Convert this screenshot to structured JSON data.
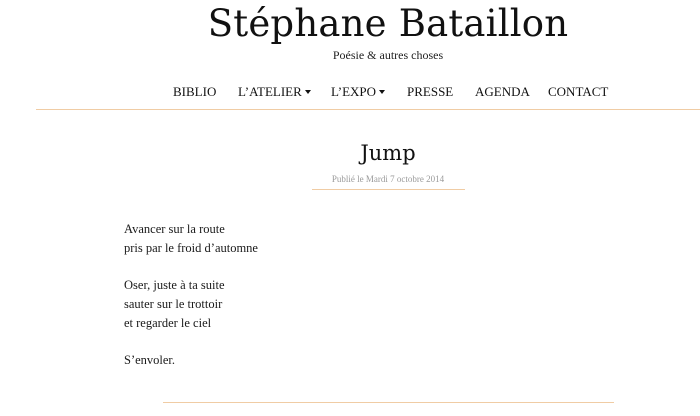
{
  "site": {
    "title": "Stéphane Bataillon",
    "tagline": "Poésie & autres choses"
  },
  "nav": {
    "items": [
      {
        "label": "BIBLIO",
        "has_dropdown": false
      },
      {
        "label": "L’ATELIER",
        "has_dropdown": true
      },
      {
        "label": "L’EXPO",
        "has_dropdown": true
      },
      {
        "label": "PRESSE",
        "has_dropdown": false
      },
      {
        "label": "AGENDA",
        "has_dropdown": false
      },
      {
        "label": "CONTACT",
        "has_dropdown": false
      }
    ]
  },
  "post": {
    "title": "Jump",
    "meta": "Publié le Mardi 7 octobre 2014",
    "stanzas": [
      [
        "Avancer sur la route",
        "pris par le froid d’automne"
      ],
      [
        "Oser, juste à ta suite",
        "sauter sur le trottoir",
        "et regarder le ciel"
      ],
      [
        "S’envoler."
      ]
    ]
  },
  "colors": {
    "accent_rule": "#f0cca4",
    "meta_text": "#9a9a9a"
  }
}
